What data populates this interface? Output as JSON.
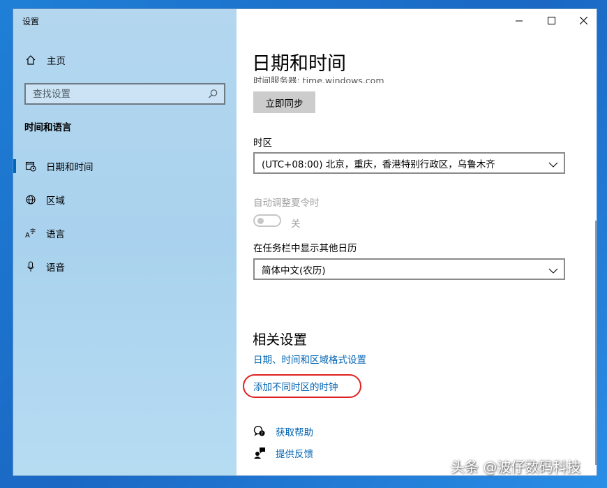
{
  "window": {
    "title": "设置"
  },
  "sidebar": {
    "home_label": "主页",
    "search_placeholder": "查找设置",
    "section_heading": "时间和语言",
    "items": [
      {
        "label": "日期和时间",
        "icon": "calendar-clock-icon",
        "active": true
      },
      {
        "label": "区域",
        "icon": "globe-icon"
      },
      {
        "label": "语言",
        "icon": "language-icon"
      },
      {
        "label": "语音",
        "icon": "microphone-icon"
      }
    ]
  },
  "content": {
    "page_title": "日期和时间",
    "time_server": "时间服务器: time.windows.com",
    "sync_button": "立即同步",
    "timezone_label": "时区",
    "timezone_value": "(UTC+08:00) 北京，重庆，香港特别行政区，乌鲁木齐",
    "dst_label": "自动调整夏令时",
    "dst_state": "关",
    "calendar_label": "在任务栏中显示其他日历",
    "calendar_value": "简体中文(农历)",
    "related_heading": "相关设置",
    "related_links": [
      "日期、时间和区域格式设置",
      "添加不同时区的时钟"
    ],
    "help_label": "获取帮助",
    "feedback_label": "提供反馈"
  },
  "watermark": "头条 @波仔数码科技",
  "colors": {
    "accent": "#0067c0",
    "link": "#0063b1",
    "highlight": "#e02020",
    "sidebar_bg": "#b4d7ef"
  }
}
